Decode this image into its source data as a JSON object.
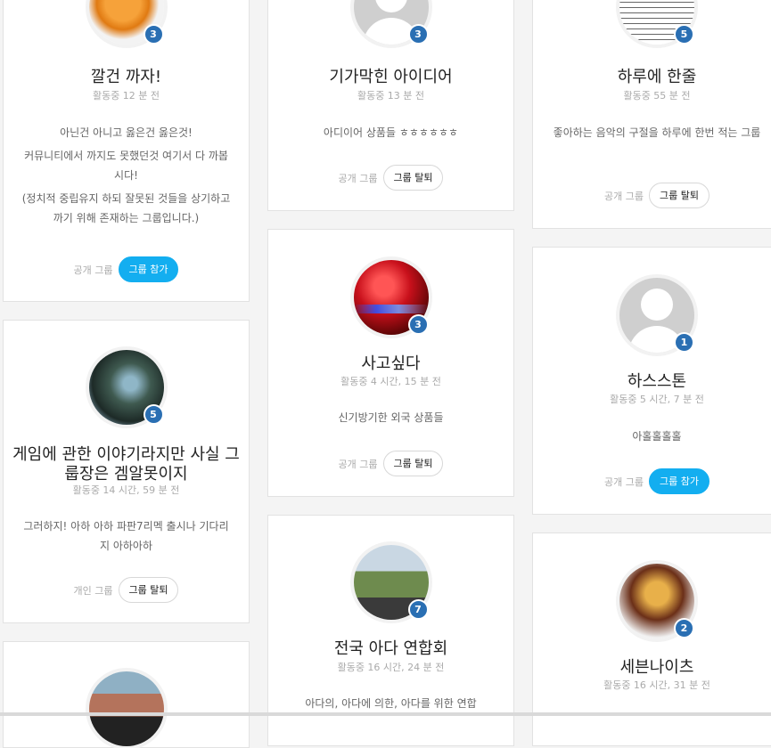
{
  "cards": {
    "c1": {
      "title": "깔건 까자!",
      "activity": "활동중 12 분 전",
      "desc": [
        "아닌건 아니고 옳은건 옳은것!",
        "커뮤니티에서 까지도 못했던것 여기서 다 까봅시다!",
        "(정치적 중립유지 하되 잘못된 것들을 상기하고 까기 위해 존재하는 그룹입니다.)"
      ],
      "member_count": "3",
      "group_type": "공개 그룹",
      "action": "그룹 참가",
      "avatar": "tangerine-photo"
    },
    "c2": {
      "title": "게임에 관한 이야기라지만 사실 그룹장은 겜알못이지",
      "activity": "활동중 14 시간, 59 분 전",
      "desc": [
        "그러하지! 아하 아하 파판7리멕 출시나 기다리지 아하아하"
      ],
      "member_count": "5",
      "group_type": "개인 그룹",
      "action": "그룹 탈퇴",
      "avatar": "halo-photo"
    },
    "c3": {
      "title": "기가막힌 아이디어",
      "activity": "활동중 13 분 전",
      "desc": [
        "아디이어 상품들 ㅎㅎㅎㅎㅎㅎ"
      ],
      "member_count": "3",
      "group_type": "공개 그룹",
      "action": "그룹 탈퇴",
      "avatar": "default-person"
    },
    "c4": {
      "title": "사고싶다",
      "activity": "활동중 4 시간, 15 분 전",
      "desc": [
        "신기방기한 외국 상품들"
      ],
      "member_count": "3",
      "group_type": "공개 그룹",
      "action": "그룹 탈퇴",
      "avatar": "red-mouse-photo"
    },
    "c5": {
      "title": "전국 아다 연합회",
      "activity": "활동중 16 시간, 24 분 전",
      "desc": [
        "아다의, 아다에 의한, 아다를 위한 연합"
      ],
      "member_count": "7",
      "avatar": "people-photo"
    },
    "c6": {
      "title": "하루에 한줄",
      "activity": "활동중 55 분 전",
      "desc": [
        "좋아하는 음악의 구절을 하루에 한번 적는 그룹"
      ],
      "member_count": "5",
      "group_type": "공개 그룹",
      "action": "그룹 탈퇴",
      "avatar": "sheet-music-photo"
    },
    "c7": {
      "title": "하스스톤",
      "activity": "활동중 5 시간, 7 분 전",
      "desc": [
        "아홀홀홀홀"
      ],
      "member_count": "1",
      "group_type": "공개 그룹",
      "action": "그룹 참가",
      "avatar": "default-person"
    },
    "c8": {
      "title": "세븐나이츠",
      "activity": "활동중 16 시간, 31 분 전",
      "member_count": "2",
      "avatar": "seven-knights-logo"
    },
    "c9": {
      "member_count": "",
      "avatar": "man-photo"
    }
  },
  "colors": {
    "join_button": "#13aef0",
    "badge": "#2a6fb3",
    "leave_button_border": "#d8d8d8"
  }
}
